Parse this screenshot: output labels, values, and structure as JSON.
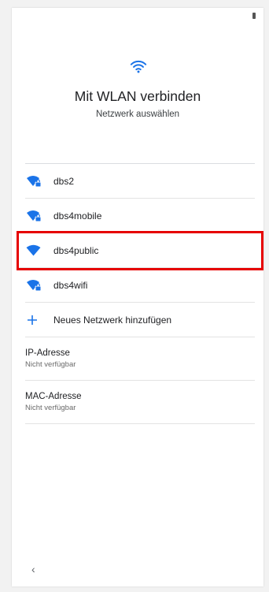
{
  "header": {
    "title": "Mit WLAN verbinden",
    "subtitle": "Netzwerk auswählen",
    "icon": "wifi-icon",
    "accent": "#1a73e8"
  },
  "networks": [
    {
      "ssid": "dbs2",
      "locked": true
    },
    {
      "ssid": "dbs4mobile",
      "locked": true
    },
    {
      "ssid": "dbs4public",
      "locked": false,
      "highlighted": true
    },
    {
      "ssid": "dbs4wifi",
      "locked": true
    }
  ],
  "add_network": {
    "label": "Neues Netzwerk hinzufügen",
    "icon": "plus-icon"
  },
  "ip": {
    "label": "IP-Adresse",
    "value": "Nicht verfügbar"
  },
  "mac": {
    "label": "MAC-Adresse",
    "value": "Nicht verfügbar"
  },
  "nav": {
    "back_glyph": "‹"
  },
  "highlight_color": "#e60000"
}
